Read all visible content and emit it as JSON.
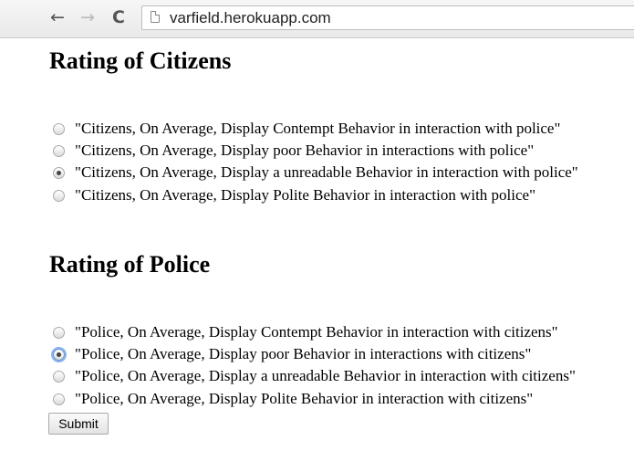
{
  "browser": {
    "back_icon": "←",
    "forward_icon": "→",
    "reload_icon": "C",
    "url": "varfield.herokuapp.com"
  },
  "citizens": {
    "title": "Rating of Citizens",
    "options": [
      {
        "label": "\"Citizens, On Average, Display Contempt Behavior in interaction with police\"",
        "checked": false
      },
      {
        "label": "\"Citizens, On Average, Display poor Behavior in interactions with police\"",
        "checked": false
      },
      {
        "label": "\"Citizens, On Average, Display a unreadable Behavior in interaction with police\"",
        "checked": true
      },
      {
        "label": "\"Citizens, On Average, Display Polite Behavior in interaction with police\"",
        "checked": false
      }
    ]
  },
  "police": {
    "title": "Rating of Police",
    "options": [
      {
        "label": "\"Police, On Average, Display Contempt Behavior in interaction with citizens\"",
        "checked": false
      },
      {
        "label": "\"Police, On Average, Display poor Behavior in interactions with citizens\"",
        "checked": true
      },
      {
        "label": "\"Police, On Average, Display a unreadable Behavior in interaction with citizens\"",
        "checked": false
      },
      {
        "label": "\"Police, On Average, Display Polite Behavior in interaction with citizens\"",
        "checked": false
      }
    ]
  },
  "submit_label": "Submit"
}
